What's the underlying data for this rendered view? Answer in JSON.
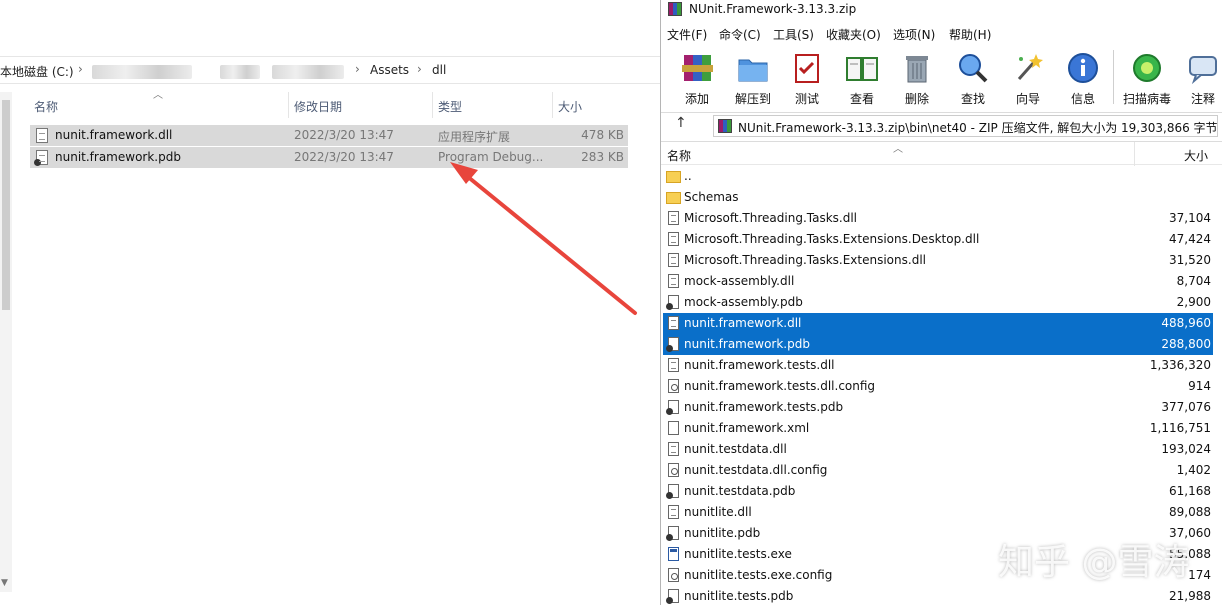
{
  "explorer": {
    "breadcrumb": {
      "root": "本地磁盘 (C:)",
      "assets": "Assets",
      "dll": "dll"
    },
    "columns": {
      "name": "名称",
      "modified": "修改日期",
      "type": "类型",
      "size": "大小"
    },
    "files": [
      {
        "name": "nunit.framework.dll",
        "modified": "2022/3/20 13:47",
        "type": "应用程序扩展",
        "size": "478 KB",
        "icon": "dll-file-icon"
      },
      {
        "name": "nunit.framework.pdb",
        "modified": "2022/3/20 13:47",
        "type": "Program Debug...",
        "size": "283 KB",
        "icon": "pdb-file-icon"
      }
    ],
    "annotation_arrow_color": "#e8453c"
  },
  "winrar": {
    "title": "NUnit.Framework-3.13.3.zip",
    "menu": [
      "文件(F)",
      "命令(C)",
      "工具(S)",
      "收藏夹(O)",
      "选项(N)",
      "帮助(H)"
    ],
    "toolbar": [
      "添加",
      "解压到",
      "测试",
      "查看",
      "删除",
      "查找",
      "向导",
      "信息",
      "扫描病毒",
      "注释"
    ],
    "path": "NUnit.Framework-3.13.3.zip\\bin\\net40 - ZIP 压缩文件, 解包大小为 19,303,866 字节",
    "columns": {
      "name": "名称",
      "size": "大小"
    },
    "rows": [
      {
        "name": "..",
        "size": "",
        "icon": "folder",
        "selected": false
      },
      {
        "name": "Schemas",
        "size": "",
        "icon": "folder",
        "selected": false
      },
      {
        "name": "Microsoft.Threading.Tasks.dll",
        "size": "37,104",
        "icon": "dll",
        "selected": false
      },
      {
        "name": "Microsoft.Threading.Tasks.Extensions.Desktop.dll",
        "size": "47,424",
        "icon": "dll",
        "selected": false
      },
      {
        "name": "Microsoft.Threading.Tasks.Extensions.dll",
        "size": "31,520",
        "icon": "dll",
        "selected": false
      },
      {
        "name": "mock-assembly.dll",
        "size": "8,704",
        "icon": "dll",
        "selected": false
      },
      {
        "name": "mock-assembly.pdb",
        "size": "2,900",
        "icon": "pdb",
        "selected": false
      },
      {
        "name": "nunit.framework.dll",
        "size": "488,960",
        "icon": "dll",
        "selected": true
      },
      {
        "name": "nunit.framework.pdb",
        "size": "288,800",
        "icon": "pdb",
        "selected": true
      },
      {
        "name": "nunit.framework.tests.dll",
        "size": "1,336,320",
        "icon": "dll",
        "selected": false
      },
      {
        "name": "nunit.framework.tests.dll.config",
        "size": "914",
        "icon": "cfg",
        "selected": false
      },
      {
        "name": "nunit.framework.tests.pdb",
        "size": "377,076",
        "icon": "pdb",
        "selected": false
      },
      {
        "name": "nunit.framework.xml",
        "size": "1,116,751",
        "icon": "xml",
        "selected": false
      },
      {
        "name": "nunit.testdata.dll",
        "size": "193,024",
        "icon": "dll",
        "selected": false
      },
      {
        "name": "nunit.testdata.dll.config",
        "size": "1,402",
        "icon": "cfg",
        "selected": false
      },
      {
        "name": "nunit.testdata.pdb",
        "size": "61,168",
        "icon": "pdb",
        "selected": false
      },
      {
        "name": "nunitlite.dll",
        "size": "89,088",
        "icon": "dll",
        "selected": false
      },
      {
        "name": "nunitlite.pdb",
        "size": "37,060",
        "icon": "pdb",
        "selected": false
      },
      {
        "name": "nunitlite.tests.exe",
        "size": "55,088",
        "icon": "exe",
        "selected": false
      },
      {
        "name": "nunitlite.tests.exe.config",
        "size": "174",
        "icon": "cfg",
        "selected": false
      },
      {
        "name": "nunitlite.tests.pdb",
        "size": "21,988",
        "icon": "pdb",
        "selected": false
      }
    ]
  },
  "watermark": "知乎 @雪涛",
  "colors": {
    "selection": "#0a6fc9",
    "explorer_selection": "#d9d9d9",
    "arrow": "#e8453c"
  }
}
